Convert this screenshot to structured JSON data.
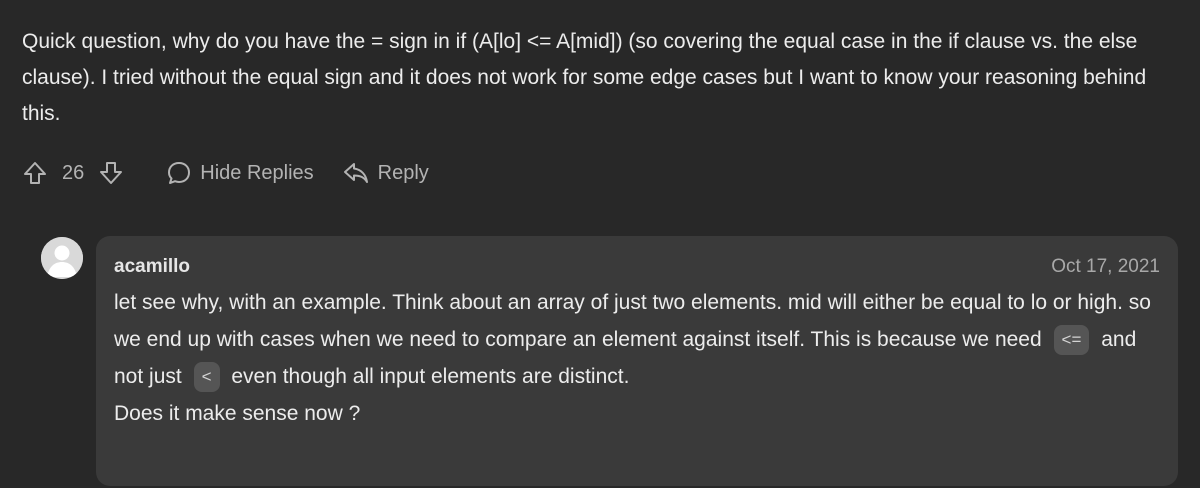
{
  "comment": {
    "text": "Quick question, why do you have the = sign in if (A[lo] <= A[mid]) (so covering the equal case in the if clause vs. the else clause). I tried without the equal sign and it does not work for some edge cases but I want to know your reasoning behind this.",
    "vote_count": "26",
    "hide_replies_label": "Hide Replies",
    "reply_label": "Reply"
  },
  "reply": {
    "author": "acamillo",
    "date": "Oct 17, 2021",
    "body_part1": "let see why, with an example. Think about an array of just two elements. mid will either be equal to lo or high. so we end up with cases when we need to compare an element against itself. This is because we need",
    "code1": "<=",
    "body_part2": "and not just",
    "code2": "<",
    "body_part3": "even though all input elements are distinct.",
    "body_last": "Does it make sense now ?"
  },
  "icons": {
    "upvote": "arrow-up-icon",
    "downvote": "arrow-down-icon",
    "hide_replies": "chat-bubble-icon",
    "reply": "reply-arrow-icon",
    "avatar": "user-avatar"
  },
  "colors": {
    "background": "#282828",
    "card": "#3a3a3a",
    "text": "#ececec",
    "muted": "#b3b3b3"
  }
}
